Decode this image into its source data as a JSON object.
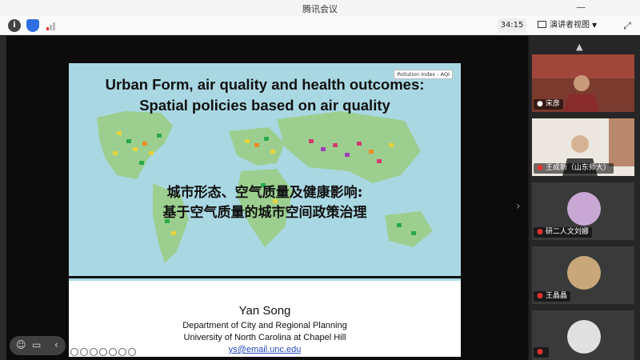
{
  "app": {
    "title": "腾讯会议",
    "minimize": "—"
  },
  "toolbar": {
    "info_icon": "i",
    "shield_icon": "shield-icon",
    "signal_icon": "signal-icon",
    "timer": "34:15",
    "view_label": "演讲者视图",
    "fullscreen_icon": "⤢"
  },
  "slide": {
    "title_line1": "Urban Form, air quality and health outcomes:",
    "title_line2": "Spatial policies based on air quality",
    "map_tag": "Pollution Index - AQI",
    "cn_line1": "城市形态、空气质量及健康影响:",
    "cn_line2": "基于空气质量的城市空间政策治理",
    "author": "Yan Song",
    "affiliation1": "Department of City and Regional Planning",
    "affiliation2": "University of North Carolina at Chapel Hill",
    "email": "ys@email.unc.edu"
  },
  "participants": [
    {
      "name": "宋彦",
      "muted": false
    },
    {
      "name": "王成新（山东师大）",
      "muted": true
    },
    {
      "name": "研二人文刘娜",
      "muted": true
    },
    {
      "name": "王晶晶",
      "muted": true
    },
    {
      "name": "",
      "muted": true
    }
  ],
  "colors": {
    "accent": "#2f6fe4",
    "muted_mic": "#e33333",
    "map_ocean": "#a9d8e3",
    "map_land": "#8fc79a"
  }
}
